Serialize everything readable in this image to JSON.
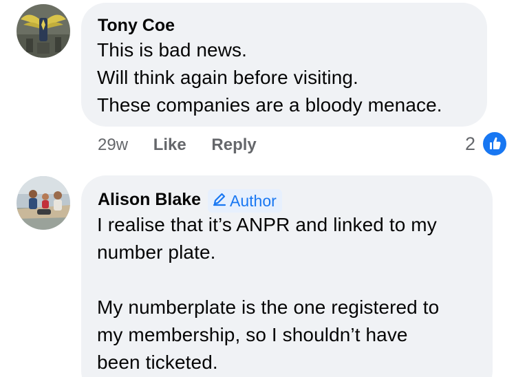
{
  "comments": [
    {
      "author": "Tony Coe",
      "lines": [
        "This is bad news.",
        "Will think again before visiting.",
        "These companies are a bloody menace."
      ],
      "time": "29w",
      "like_label": "Like",
      "reply_label": "Reply",
      "reaction_count": "2",
      "reaction_icon": "thumbs-up-icon",
      "avatar_icon": "winged-emblem-avatar"
    },
    {
      "author": "Alison Blake",
      "badge": "Author",
      "badge_icon": "pencil-icon",
      "lines": [
        "I realise that it’s ANPR and linked to my",
        "number plate.",
        "",
        "My numberplate is the one registered to",
        "my membership, so I shouldn’t have",
        "been ticketed."
      ],
      "avatar_icon": "family-photo-avatar"
    }
  ],
  "colors": {
    "bubble": "#f0f2f5",
    "secondary_text": "#65676b",
    "accent": "#1877f2",
    "badge_bg": "#e7f0fd"
  }
}
